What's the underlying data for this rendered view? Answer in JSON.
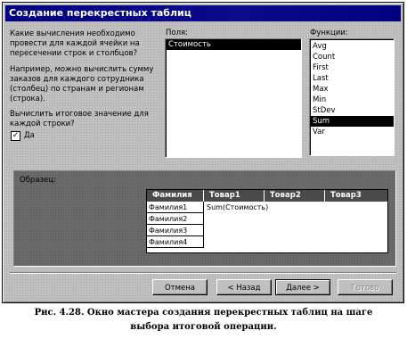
{
  "window": {
    "title": "Создание перекрестных таблиц"
  },
  "left_text": {
    "question": [
      "Какие вычисления необходимо",
      "провести для каждой ячейки на",
      "пересечении строк и столбцов?"
    ],
    "example": [
      "Например, можно вычислить сумму",
      "заказов для каждого сотрудника",
      "(столбец) по странам и регионам",
      "(строка)."
    ],
    "total_question": [
      "Вычислить итоговое значение для",
      "каждой строки?"
    ],
    "checkbox_label": "Да",
    "checkbox_checked": true
  },
  "fields": {
    "label": "Поля:",
    "items": [
      "Стоимость"
    ],
    "selected_index": 0
  },
  "functions": {
    "label": "Функции:",
    "items": [
      "Avg",
      "Count",
      "First",
      "Last",
      "Max",
      "Min",
      "StDev",
      "Sum",
      "Var"
    ],
    "selected_index": 7
  },
  "sample": {
    "label": "Образец:",
    "headers": [
      "Фамилия",
      "Товар1",
      "Товар2",
      "Товар3"
    ],
    "rows": [
      "Фамилия1",
      "Фамилия2",
      "Фамилия3",
      "Фамилия4"
    ],
    "cell_value": "Sum(Стоимость)"
  },
  "buttons": {
    "cancel": "Отмена",
    "back": "< Назад",
    "next": "Далее >",
    "finish": "Готово"
  },
  "caption": {
    "line1": "Рис. 4.28. Окно мастера создания перекрестных таблиц на шаге",
    "line2": "выбора итоговой операции."
  }
}
